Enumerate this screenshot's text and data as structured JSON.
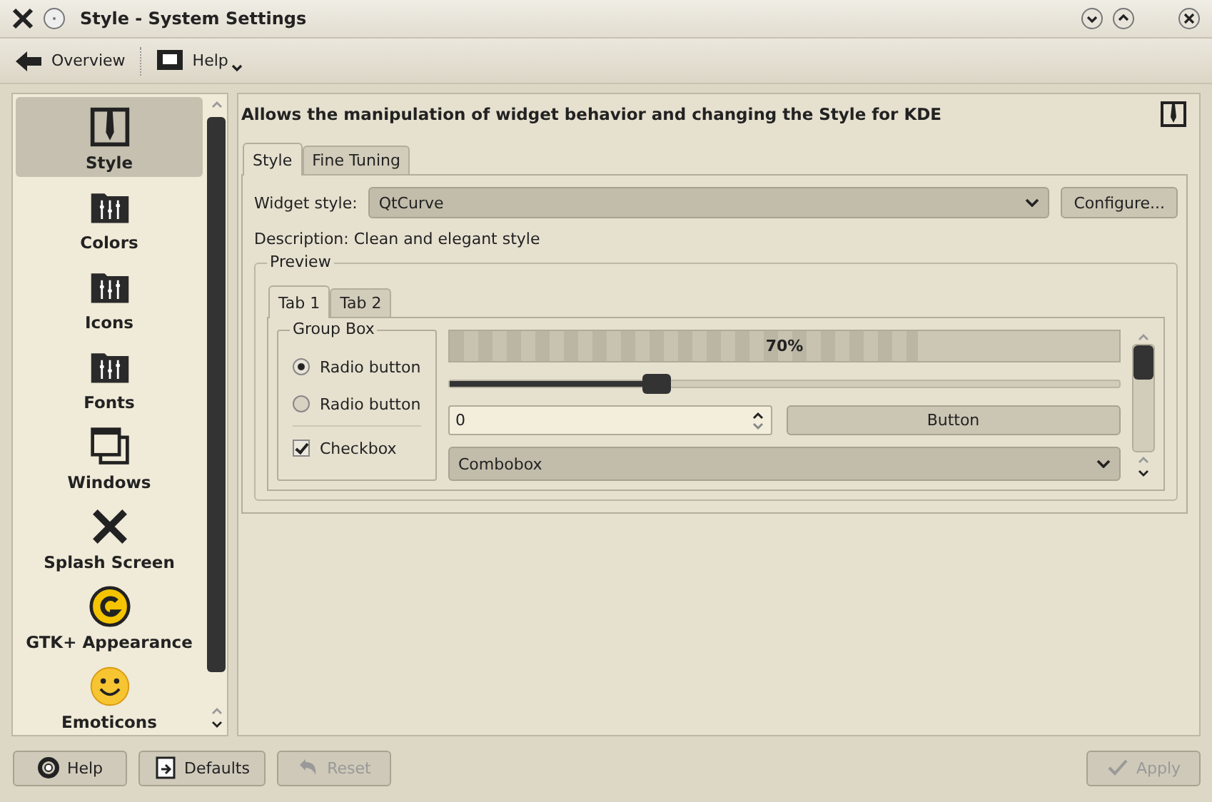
{
  "window": {
    "title": "Style - System Settings"
  },
  "toolbar": [
    {
      "kind": "back",
      "label": "Overview"
    },
    {
      "kind": "help",
      "label": "Help"
    }
  ],
  "sidebar": {
    "items": [
      {
        "kind": "tie",
        "label": "Style",
        "selected": true
      },
      {
        "kind": "sliders",
        "label": "Colors",
        "selected": false
      },
      {
        "kind": "sliders",
        "label": "Icons",
        "selected": false
      },
      {
        "kind": "sliders",
        "label": "Fonts",
        "selected": false
      },
      {
        "kind": "windows",
        "label": "Windows",
        "selected": false
      },
      {
        "kind": "tools",
        "label": "Splash Screen",
        "selected": false
      },
      {
        "kind": "gtk",
        "label": "GTK+ Appearance",
        "selected": false
      },
      {
        "kind": "smiley",
        "label": "Emoticons",
        "selected": false
      }
    ]
  },
  "header": "Allows the manipulation of widget behavior and changing the Style for KDE",
  "tabs": [
    {
      "label": "Style",
      "selected": true
    },
    {
      "label": "Fine Tuning",
      "selected": false
    }
  ],
  "widget_style": {
    "label": "Widget style:",
    "value": "QtCurve",
    "button": "Configure..."
  },
  "description": "Description: Clean and elegant style",
  "preview": {
    "title": "Preview",
    "tabs": [
      {
        "label": "Tab 1",
        "selected": true
      },
      {
        "label": "Tab 2",
        "selected": false
      }
    ],
    "group_box": {
      "title": "Group Box",
      "radios": [
        {
          "label": "Radio button",
          "selected": true
        },
        {
          "label": "Radio button",
          "selected": false
        }
      ],
      "checkbox": {
        "label": "Checkbox",
        "checked": true
      }
    },
    "progress": {
      "level": 0.7,
      "text": "70%"
    },
    "slider": {
      "level": 0.31
    },
    "spinbox": {
      "value": "0"
    },
    "button": "Button",
    "combobox": "Combobox"
  },
  "buttons": [
    {
      "kind": "help",
      "label": "Help",
      "disabled": false
    },
    {
      "kind": "defaults",
      "label": "Defaults",
      "disabled": false
    },
    {
      "kind": "reset",
      "label": "Reset",
      "disabled": true
    },
    {
      "kind": "apply",
      "label": "Apply",
      "disabled": true
    }
  ]
}
